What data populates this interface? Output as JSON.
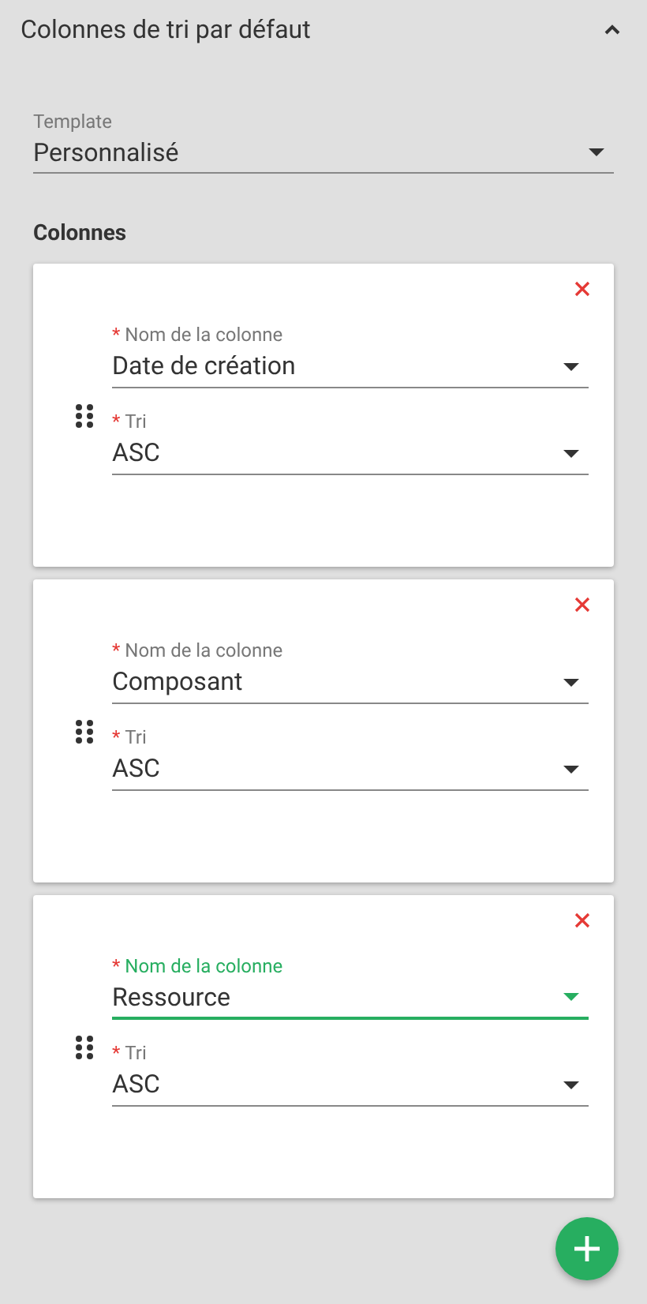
{
  "section": {
    "title": "Colonnes de tri par défaut",
    "expanded": true
  },
  "template": {
    "label": "Template",
    "value": "Personnalisé"
  },
  "columns_heading": "Colonnes",
  "columns": [
    {
      "fields": [
        {
          "required_mark": "*",
          "label": "Nom de la colonne",
          "value": "Date de création",
          "focused": false
        },
        {
          "required_mark": "*",
          "label": "Tri",
          "value": "ASC",
          "focused": false
        }
      ]
    },
    {
      "fields": [
        {
          "required_mark": "*",
          "label": "Nom de la colonne",
          "value": "Composant",
          "focused": false
        },
        {
          "required_mark": "*",
          "label": "Tri",
          "value": "ASC",
          "focused": false
        }
      ]
    },
    {
      "fields": [
        {
          "required_mark": "*",
          "label": "Nom de la colonne",
          "value": "Ressource",
          "focused": true
        },
        {
          "required_mark": "*",
          "label": "Tri",
          "value": "ASC",
          "focused": false
        }
      ]
    }
  ]
}
